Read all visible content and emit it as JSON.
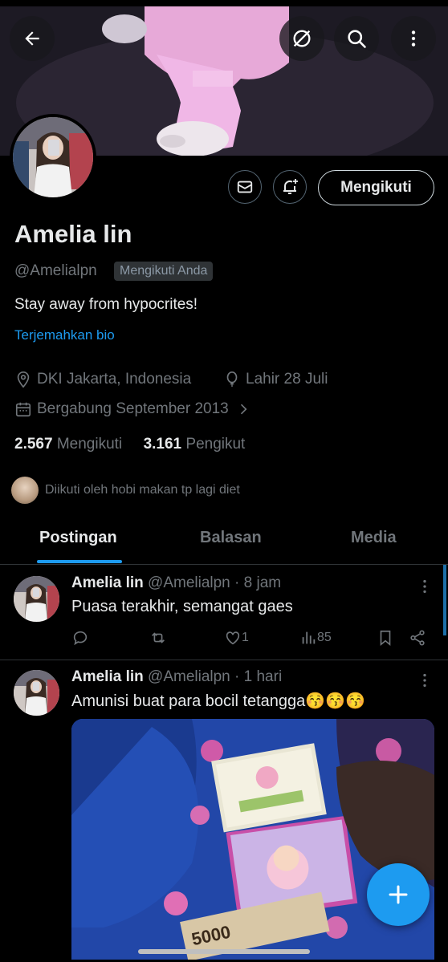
{
  "profile": {
    "name": "Amelia lin",
    "handle": "@Amelialpn",
    "follows_you": "Mengikuti Anda",
    "bio": "Stay away from hypocrites!",
    "translate_bio": "Terjemahkan bio",
    "location": "DKI Jakarta, Indonesia",
    "birthday": "Lahir 28 Juli",
    "joined": "Bergabung September 2013",
    "following_count": "2.567",
    "following_label": "Mengikuti",
    "followers_count": "3.161",
    "followers_label": "Pengikut",
    "followed_by": "Diikuti oleh hobi makan tp lagi diet"
  },
  "header": {
    "back_icon": "arrow-left-icon",
    "translate_icon": "no-translate-icon",
    "search_icon": "search-icon",
    "more_icon": "more-vertical-icon"
  },
  "buttons": {
    "message_icon": "envelope-icon",
    "notify_icon": "bell-plus-icon",
    "follow_label": "Mengikuti"
  },
  "tabs": [
    {
      "label": "Postingan",
      "active": true
    },
    {
      "label": "Balasan",
      "active": false
    },
    {
      "label": "Media",
      "active": false
    }
  ],
  "posts": [
    {
      "name": "Amelia lin",
      "meta": "@Amelialpn · 8 jam",
      "text": "Puasa terakhir, semangat gaes",
      "likes": "1",
      "views": "85"
    },
    {
      "name": "Amelia lin",
      "meta": "@Amelialpn · 1 hari",
      "text": "Amunisi buat para bocil tetangga😚😚😚",
      "image_banknote_text": "5000"
    }
  ],
  "colors": {
    "accent": "#1d9bf0",
    "background": "#000000",
    "text": "#e7e9ea",
    "muted": "#71767b"
  }
}
